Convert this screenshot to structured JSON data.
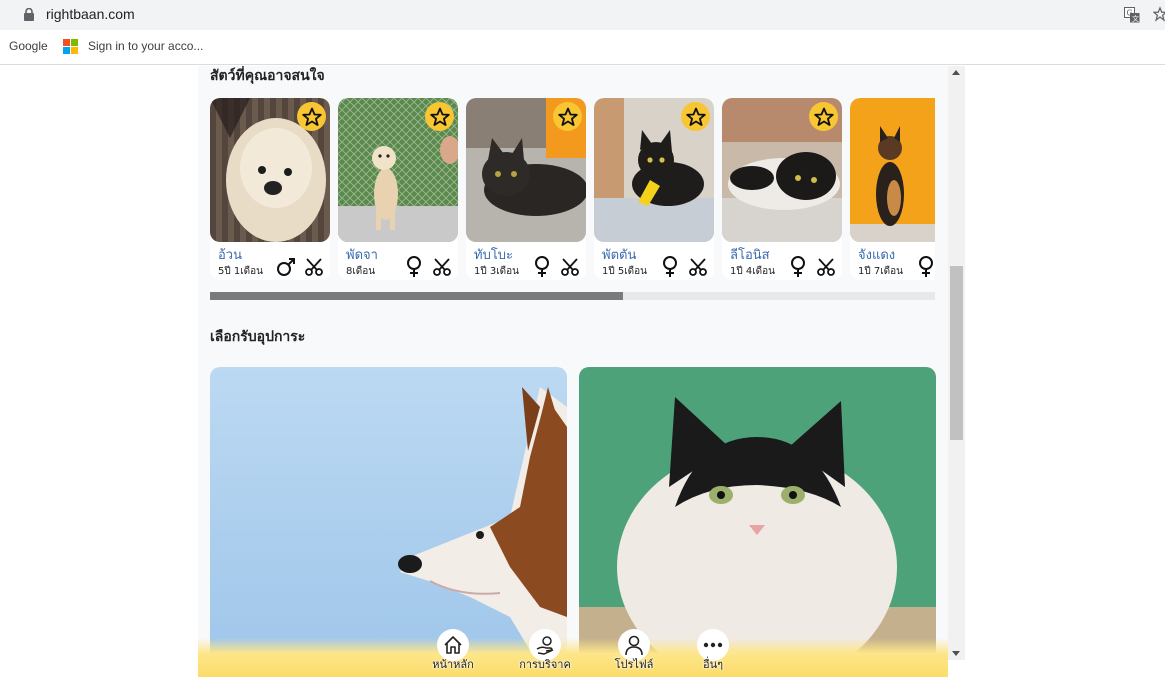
{
  "browser": {
    "url": "rightbaan.com",
    "bookmarks": [
      {
        "label": "Google"
      },
      {
        "label": "Sign in to your acco..."
      }
    ]
  },
  "sections": {
    "recommended_title": "สัตว์ที่คุณอาจสนใจ",
    "adopt_title": "เลือกรับอุปการะ"
  },
  "pets": [
    {
      "name": "อ้วน",
      "age": "5ปี 1เดือน",
      "sex": "male",
      "neutered": true
    },
    {
      "name": "พัดจา",
      "age": "8เดือน",
      "sex": "female",
      "neutered": true
    },
    {
      "name": "ทับโบะ",
      "age": "1ปี 3เดือน",
      "sex": "female",
      "neutered": true
    },
    {
      "name": "พัตตัน",
      "age": "1ปี 5เดือน",
      "sex": "female",
      "neutered": true
    },
    {
      "name": "ลีโอนิส",
      "age": "1ปี 4เดือน",
      "sex": "female",
      "neutered": true
    },
    {
      "name": "จังแดง",
      "age": "1ปี 7เดือน",
      "sex": "female",
      "neutered": false
    }
  ],
  "horizontal_scroll": {
    "position": 0.57
  },
  "bottom_nav": [
    {
      "label": "หน้าหลัก",
      "icon": "home-icon"
    },
    {
      "label": "การบริจาค",
      "icon": "donate-icon"
    },
    {
      "label": "โปรไฟล์",
      "icon": "profile-icon"
    },
    {
      "label": "อื่นๆ",
      "icon": "more-icon"
    }
  ],
  "colors": {
    "accent_yellow": "#f7c632",
    "name_blue": "#3a6ab0",
    "nav_yellow": "#fde68a"
  }
}
